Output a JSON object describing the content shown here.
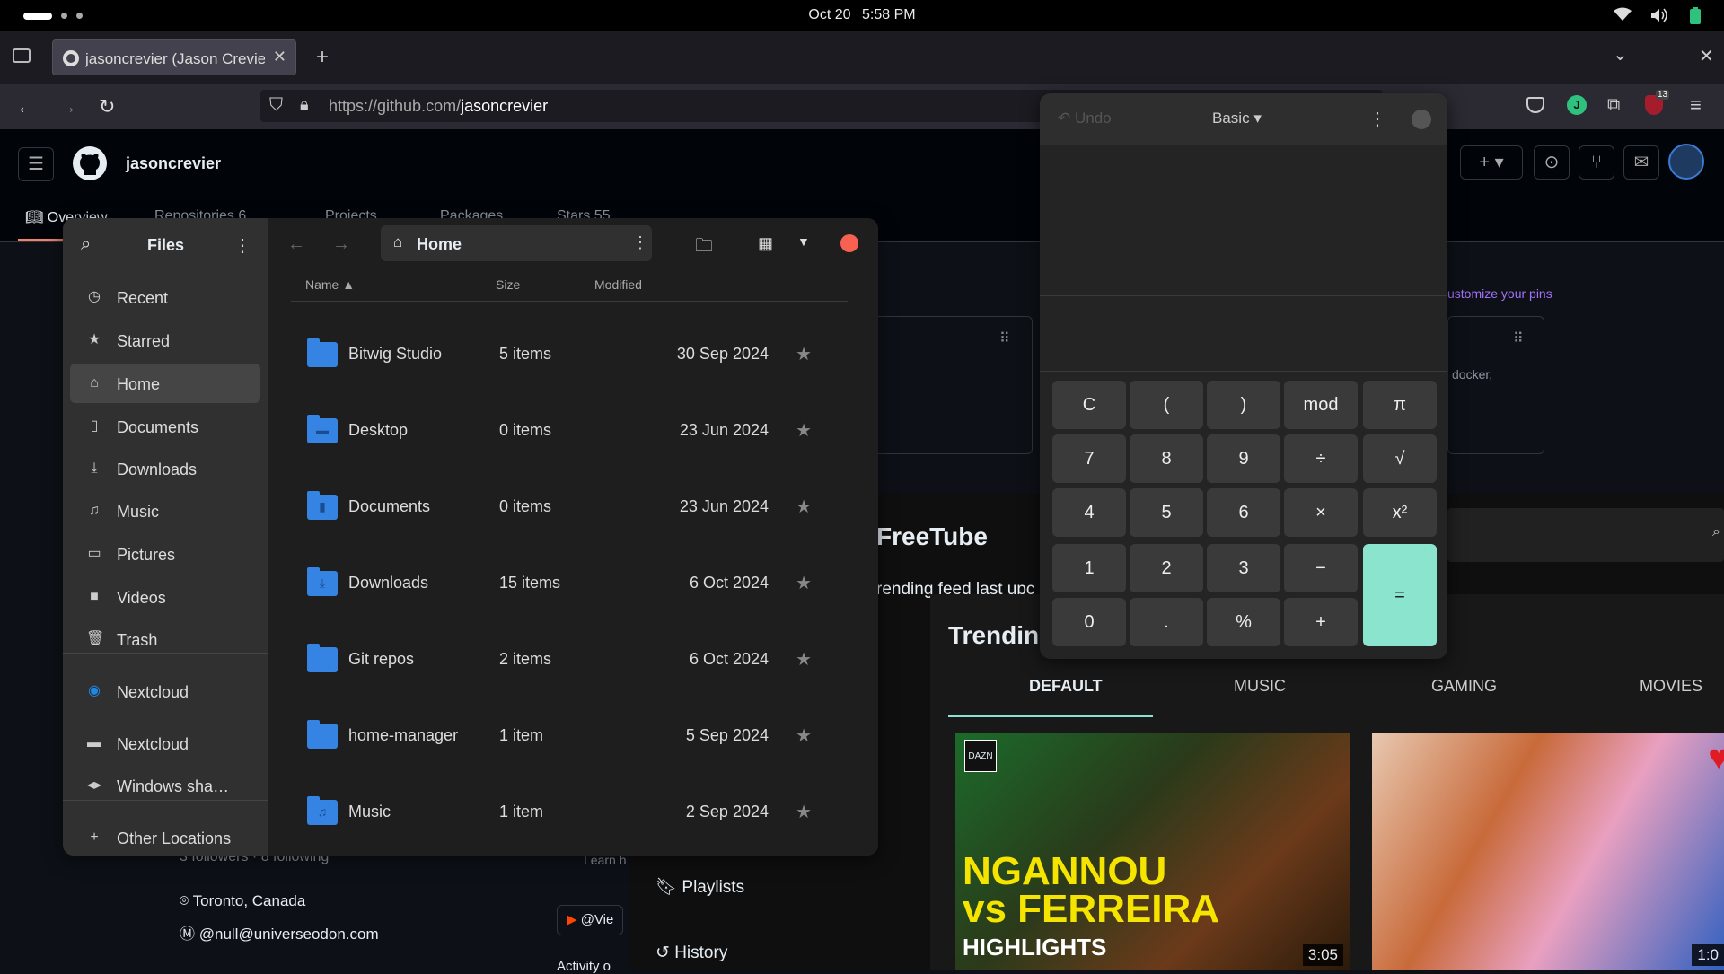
{
  "system": {
    "date": "Oct 20",
    "time": "5:58 PM"
  },
  "browser": {
    "tab_title": "jasoncrevier (Jason Crevie",
    "url_host": "https://github.com/",
    "url_path": "jasoncrevier",
    "ext_badge": "13",
    "profile_initial": "J"
  },
  "github": {
    "username": "jasoncrevier",
    "tabs": [
      {
        "label": "Overview"
      },
      {
        "label": "Repositories",
        "count": "6"
      },
      {
        "label": "Projects"
      },
      {
        "label": "Packages"
      },
      {
        "label": "Stars",
        "count": "55"
      }
    ],
    "customize": "ustomize your pins",
    "pin_text": "docker,",
    "follow_text": "3 followers · 8 following",
    "location": "Toronto, Canada",
    "mastodon": "@null@universeodon.com",
    "learn": "Learn h",
    "viewer": "@Vie",
    "activity": "Activity o"
  },
  "files": {
    "title": "Files",
    "location": "Home",
    "columns": {
      "name": "Name",
      "size": "Size",
      "modified": "Modified"
    },
    "sidebar": [
      {
        "label": "Recent",
        "icon": "clock-icon"
      },
      {
        "label": "Starred",
        "icon": "star-icon"
      },
      {
        "label": "Home",
        "icon": "home-icon"
      },
      {
        "label": "Documents",
        "icon": "document-icon"
      },
      {
        "label": "Downloads",
        "icon": "download-icon"
      },
      {
        "label": "Music",
        "icon": "music-icon"
      },
      {
        "label": "Pictures",
        "icon": "picture-icon"
      },
      {
        "label": "Videos",
        "icon": "video-icon"
      },
      {
        "label": "Trash",
        "icon": "trash-icon"
      },
      {
        "label": "Nextcloud",
        "icon": "nextcloud-icon"
      },
      {
        "label": "Nextcloud",
        "icon": "folder-icon"
      },
      {
        "label": "Windows sha…",
        "icon": "network-share-icon"
      },
      {
        "label": "Other Locations",
        "icon": "plus-icon"
      }
    ],
    "rows": [
      {
        "name": "Bitwig Studio",
        "size": "5 items",
        "modified": "30 Sep 2024",
        "glyph": ""
      },
      {
        "name": "Desktop",
        "size": "0 items",
        "modified": "23 Jun 2024",
        "glyph": "▬"
      },
      {
        "name": "Documents",
        "size": "0 items",
        "modified": "23 Jun 2024",
        "glyph": "▮"
      },
      {
        "name": "Downloads",
        "size": "15 items",
        "modified": "6 Oct 2024",
        "glyph": "⤓"
      },
      {
        "name": "Git repos",
        "size": "2 items",
        "modified": "6 Oct 2024",
        "glyph": ""
      },
      {
        "name": "home-manager",
        "size": "1 item",
        "modified": "5 Sep 2024",
        "glyph": ""
      },
      {
        "name": "Music",
        "size": "1 item",
        "modified": "2 Sep 2024",
        "glyph": "♫"
      }
    ]
  },
  "calculator": {
    "undo": "Undo",
    "mode": "Basic",
    "keys": [
      [
        "C",
        "(",
        ")",
        "mod",
        "π"
      ],
      [
        "7",
        "8",
        "9",
        "÷",
        "√"
      ],
      [
        "4",
        "5",
        "6",
        "×",
        "x²"
      ],
      [
        "1",
        "2",
        "3",
        "−"
      ],
      [
        "0",
        ".",
        "%",
        "+"
      ]
    ],
    "equals": "="
  },
  "freetube": {
    "title": "FreeTube",
    "subtitle": "rending feed last upc",
    "heading": "Trendin",
    "tabs": [
      "DEFAULT",
      "MUSIC",
      "GAMING",
      "MOVIES"
    ],
    "sidebar": [
      "Playlists",
      "History"
    ],
    "video1": {
      "logo1": "DAZN",
      "headline1": "NGANNOU",
      "headline2": "vs FERREIRA",
      "headline3": "HIGHLIGHTS",
      "duration": "3:05"
    },
    "video2": {
      "duration": "1:0"
    }
  },
  "colors": {
    "accent": "#3584e4",
    "equals": "#8ae4ce",
    "close": "#f66151"
  }
}
